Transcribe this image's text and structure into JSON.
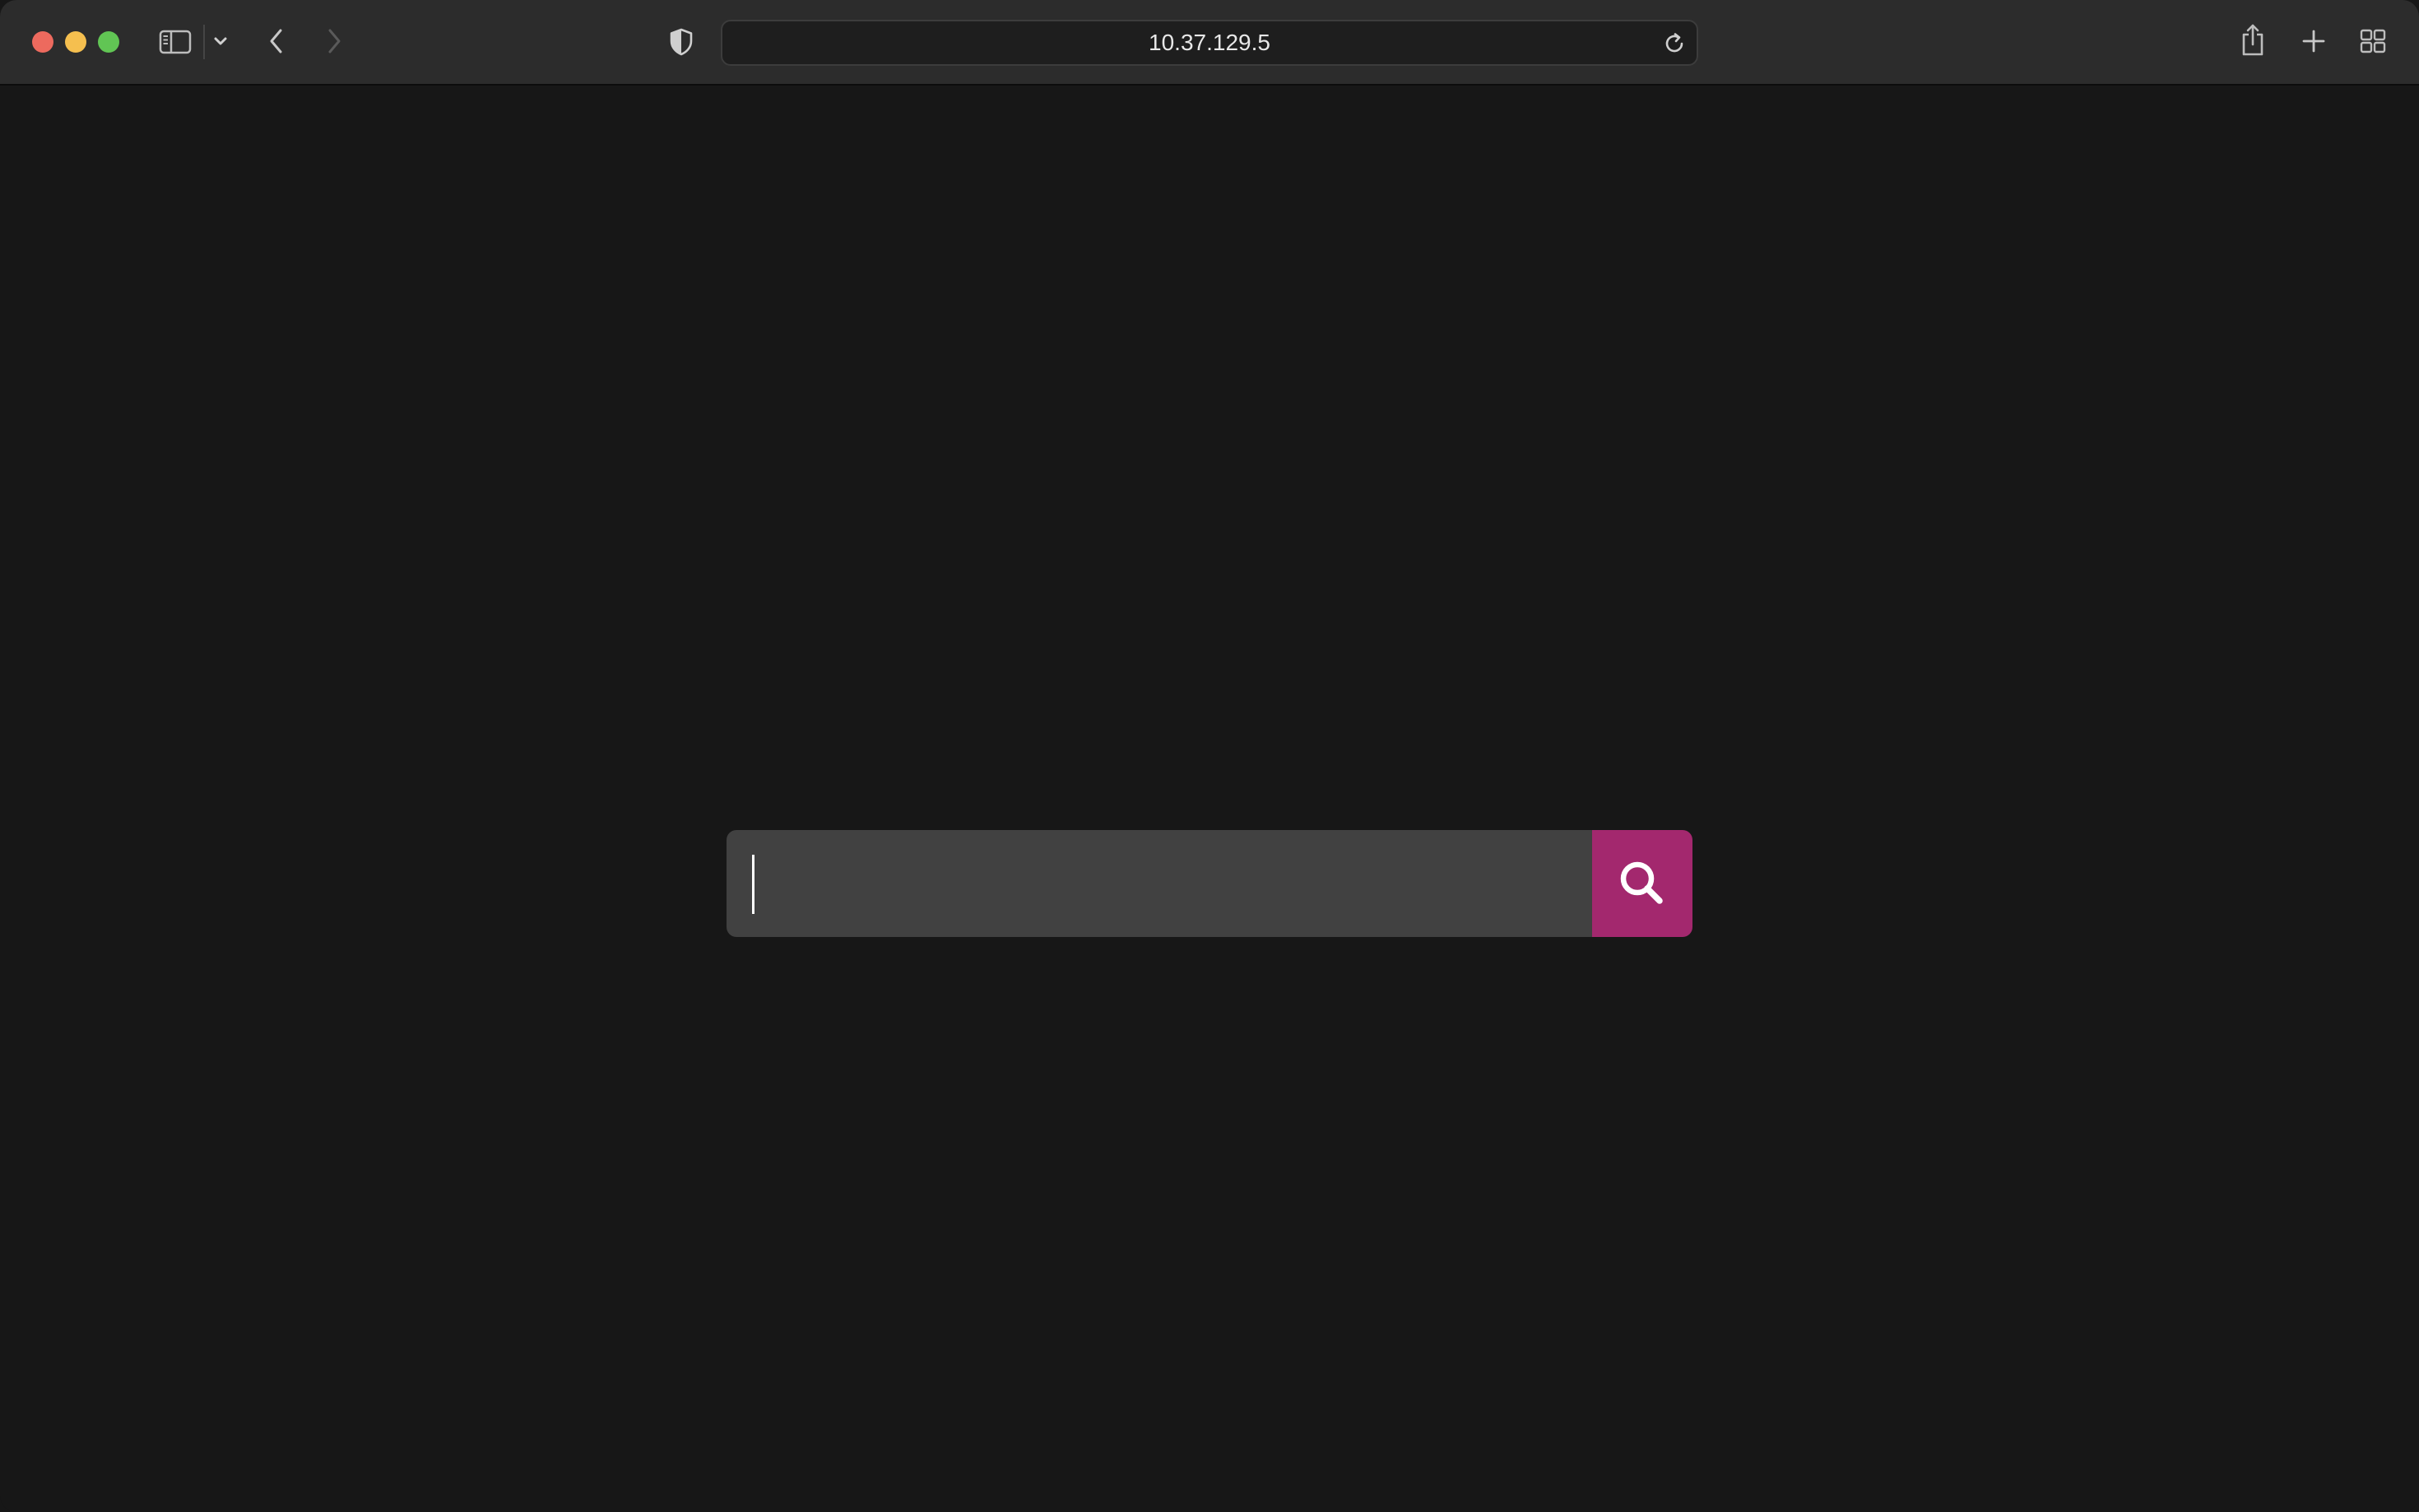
{
  "browser": {
    "address_bar": {
      "url": "10.37.129.5"
    },
    "toolbar_icons": [
      "sidebar-icon",
      "chevron-down-icon",
      "back-icon",
      "forward-icon",
      "privacy-shield-icon",
      "reload-icon",
      "share-icon",
      "new-tab-icon",
      "tab-overview-icon"
    ]
  },
  "page": {
    "search": {
      "value": "",
      "placeholder": "",
      "button_icon": "search-icon",
      "button_color": "#a3286e"
    }
  },
  "colors": {
    "page_background": "#171717",
    "toolbar_background": "#2c2c2c",
    "input_background": "#414141",
    "accent": "#a3286e"
  }
}
